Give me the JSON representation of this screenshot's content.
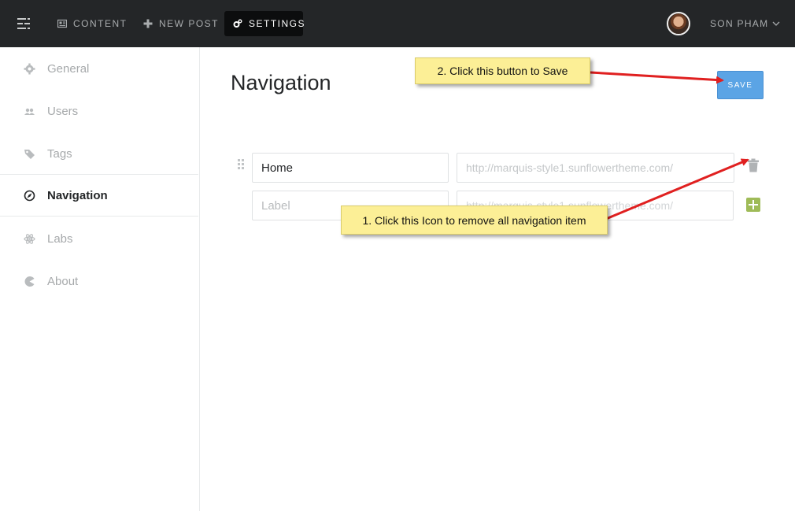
{
  "topbar": {
    "nav": [
      {
        "label": "CONTENT"
      },
      {
        "label": "NEW POST"
      },
      {
        "label": "SETTINGS"
      }
    ],
    "user_name": "SON PHAM"
  },
  "sidebar": {
    "items": [
      {
        "label": "General"
      },
      {
        "label": "Users"
      },
      {
        "label": "Tags"
      },
      {
        "label": "Navigation"
      },
      {
        "label": "Labs"
      },
      {
        "label": "About"
      }
    ]
  },
  "main": {
    "title": "Navigation",
    "save_label": "SAVE",
    "rows": [
      {
        "label": "Home",
        "url": "http://marquis-style1.sunflowertheme.com/"
      },
      {
        "label_placeholder": "Label",
        "url_placeholder": "http://marquis-style1.sunflowertheme.com/"
      }
    ]
  },
  "annotations": {
    "save_tip": "2. Click this button to Save",
    "remove_tip": "1. Click this Icon to remove all navigation item"
  },
  "colors": {
    "topbar": "#242628",
    "save": "#5ba4e5",
    "add": "#9fbb58",
    "callout": "#fcef96",
    "arrow": "#e02020"
  }
}
